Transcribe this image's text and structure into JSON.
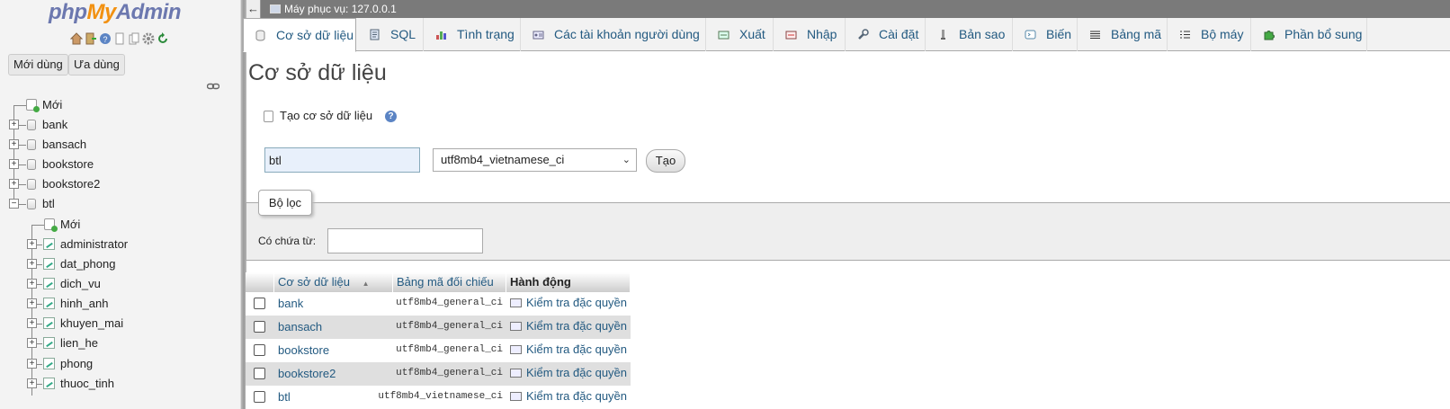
{
  "sidebar": {
    "logo": {
      "php": "php",
      "my": "My",
      "admin": "Admin"
    },
    "quick_icons": [
      "home-icon",
      "exit-icon",
      "help-icon",
      "docs-icon",
      "copy-icon",
      "settings-icon",
      "reload-icon"
    ],
    "recent_label": "Mới dùng",
    "favorites_label": "Ưa dùng",
    "tree": {
      "new_label": "Mới",
      "databases": [
        "bank",
        "bansach",
        "bookstore",
        "bookstore2",
        "btl"
      ],
      "btl_new_label": "Mới",
      "btl_tables": [
        "administrator",
        "dat_phong",
        "dich_vu",
        "hinh_anh",
        "khuyen_mai",
        "lien_he",
        "phong",
        "thuoc_tinh"
      ]
    }
  },
  "topbar": {
    "back_arrow": "←",
    "server_label": "Máy phục vụ: 127.0.0.1"
  },
  "tabs": [
    {
      "label": "Cơ sở dữ liệu",
      "icon": "database-icon",
      "active": true
    },
    {
      "label": "SQL",
      "icon": "sql-icon"
    },
    {
      "label": "Tình trạng",
      "icon": "status-icon"
    },
    {
      "label": "Các tài khoản người dùng",
      "icon": "users-icon"
    },
    {
      "label": "Xuất",
      "icon": "export-icon"
    },
    {
      "label": "Nhập",
      "icon": "import-icon"
    },
    {
      "label": "Cài đặt",
      "icon": "settings-icon"
    },
    {
      "label": "Bản sao",
      "icon": "replication-icon"
    },
    {
      "label": "Biến",
      "icon": "variables-icon"
    },
    {
      "label": "Bảng mã",
      "icon": "charset-icon"
    },
    {
      "label": "Bộ máy",
      "icon": "engine-icon"
    },
    {
      "label": "Phần bổ sung",
      "icon": "plugin-icon"
    }
  ],
  "main": {
    "title": "Cơ sở dữ liệu",
    "create": {
      "heading": "Tạo cơ sở dữ liệu",
      "db_name_value": "btl",
      "collation_value": "utf8mb4_vietnamese_ci",
      "create_button": "Tạo"
    },
    "filter": {
      "legend": "Bộ lọc",
      "contains_label": "Có chứa từ:",
      "contains_value": ""
    },
    "table": {
      "headers": [
        "Cơ sở dữ liệu",
        "Bảng mã đối chiếu",
        "Hành động"
      ],
      "sort_indicator": "▲",
      "rows": [
        {
          "name": "bank",
          "collation": "utf8mb4_general_ci",
          "action": "Kiểm tra đặc quyền"
        },
        {
          "name": "bansach",
          "collation": "utf8mb4_general_ci",
          "action": "Kiểm tra đặc quyền"
        },
        {
          "name": "bookstore",
          "collation": "utf8mb4_general_ci",
          "action": "Kiểm tra đặc quyền"
        },
        {
          "name": "bookstore2",
          "collation": "utf8mb4_general_ci",
          "action": "Kiểm tra đặc quyền"
        },
        {
          "name": "btl",
          "collation": "utf8mb4_vietnamese_ci",
          "action": "Kiểm tra đặc quyền"
        }
      ]
    }
  },
  "colors": {
    "link": "#235a81",
    "logo_blue": "#6c78af",
    "logo_orange": "#f29111",
    "topbar": "#7a7a7a"
  }
}
